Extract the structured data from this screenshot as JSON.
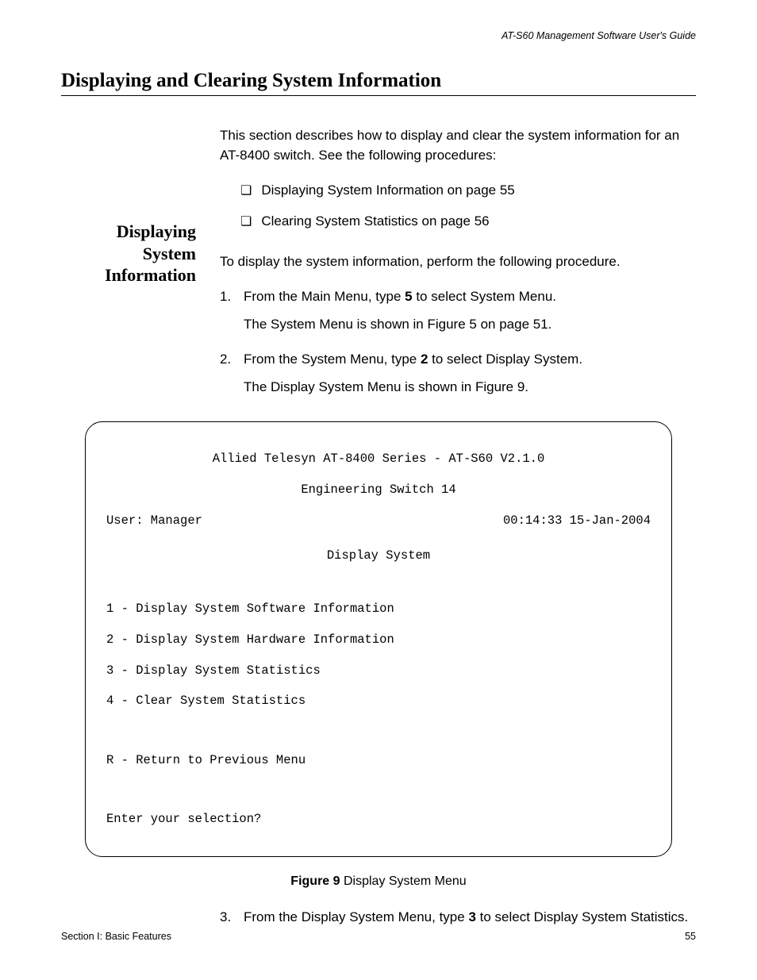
{
  "header": {
    "doc_title": "AT-S60 Management Software User's Guide"
  },
  "title": "Displaying and Clearing System Information",
  "intro": "This section describes how to display and clear the system information for an AT-8400 switch. See the following procedures:",
  "bullets": [
    "Displaying System Information on page 55",
    "Clearing System Statistics on page 56"
  ],
  "sidebar_heading": "Displaying System Information",
  "proc_intro": "To display the system information, perform the following procedure.",
  "steps": [
    {
      "num": "1.",
      "pre": "From the Main Menu, type ",
      "bold": "5",
      "post": " to select System Menu.",
      "note": "The System Menu is shown in Figure 5 on page 51."
    },
    {
      "num": "2.",
      "pre": "From the System Menu, type ",
      "bold": "2",
      "post": " to select Display System.",
      "note": "The Display System Menu is shown in Figure 9."
    }
  ],
  "menu": {
    "line1": "Allied Telesyn AT-8400 Series - AT-S60 V2.1.0",
    "line2": "Engineering Switch 14",
    "user": "User: Manager",
    "datetime": "00:14:33 15-Jan-2004",
    "title": "Display System",
    "items": [
      "1 - Display System Software Information",
      "2 - Display System Hardware Information",
      "3 - Display System Statistics",
      "4 - Clear System Statistics"
    ],
    "return": "R - Return to Previous Menu",
    "prompt": "Enter your selection?"
  },
  "figure": {
    "label": "Figure 9",
    "caption": "  Display System Menu"
  },
  "step3": {
    "num": "3.",
    "pre": "From the Display System Menu, type ",
    "bold": "3",
    "post": " to select Display System Statistics."
  },
  "footer": {
    "left": "Section I: Basic Features",
    "right": "55"
  }
}
